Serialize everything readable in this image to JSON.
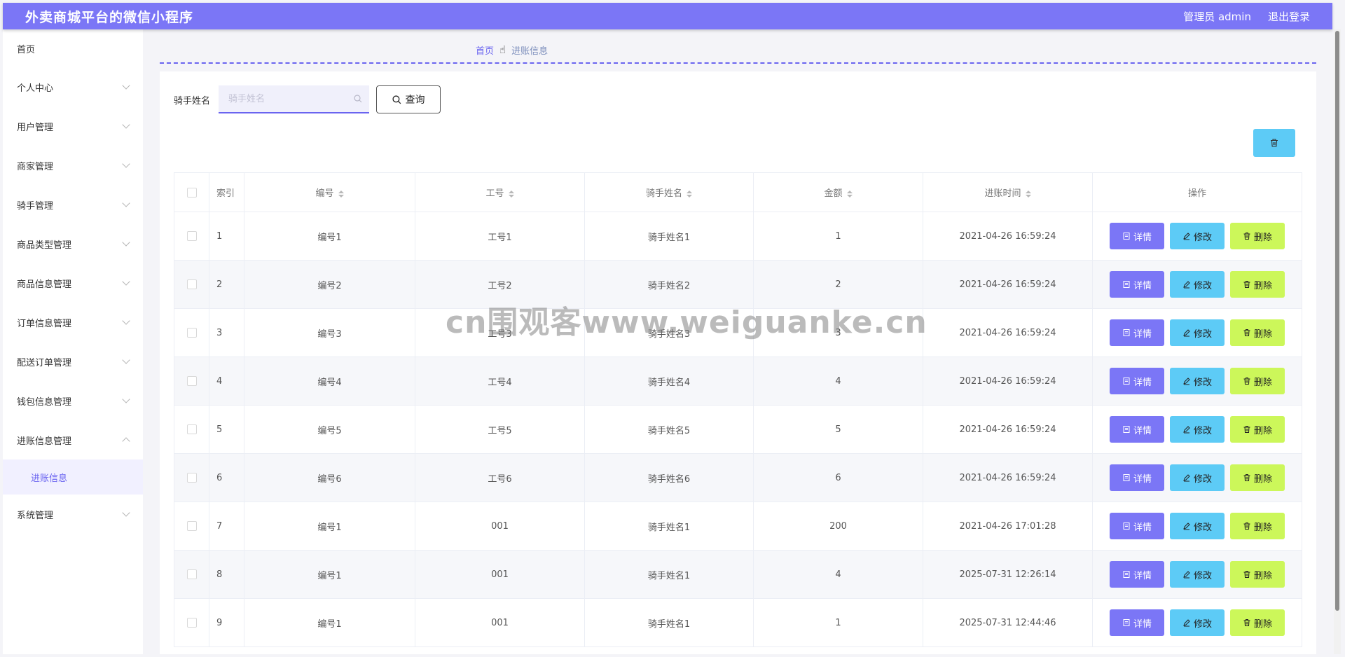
{
  "header": {
    "title": "外卖商城平台的微信小程序",
    "user": "管理员 admin",
    "logout": "退出登录"
  },
  "sidebar": {
    "items": [
      {
        "label": "首页",
        "chevron": false
      },
      {
        "label": "个人中心",
        "chevron": true
      },
      {
        "label": "用户管理",
        "chevron": true
      },
      {
        "label": "商家管理",
        "chevron": true
      },
      {
        "label": "骑手管理",
        "chevron": true
      },
      {
        "label": "商品类型管理",
        "chevron": true
      },
      {
        "label": "商品信息管理",
        "chevron": true
      },
      {
        "label": "订单信息管理",
        "chevron": true
      },
      {
        "label": "配送订单管理",
        "chevron": true
      },
      {
        "label": "钱包信息管理",
        "chevron": true
      },
      {
        "label": "进账信息管理",
        "chevron": true,
        "expanded": true
      },
      {
        "label": "系统管理",
        "chevron": true
      }
    ],
    "submenu": {
      "label": "进账信息"
    }
  },
  "breadcrumb": {
    "home": "首页",
    "current": "进账信息"
  },
  "search": {
    "label": "骑手姓名",
    "placeholder": "骑手姓名",
    "value": "",
    "button": "查询"
  },
  "table": {
    "columns": [
      "索引",
      "编号",
      "工号",
      "骑手姓名",
      "金额",
      "进账时间",
      "操作"
    ],
    "rows": [
      {
        "idx": "1",
        "bianhao": "编号1",
        "gonghao": "工号1",
        "name": "骑手姓名1",
        "amount": "1",
        "time": "2021-04-26 16:59:24"
      },
      {
        "idx": "2",
        "bianhao": "编号2",
        "gonghao": "工号2",
        "name": "骑手姓名2",
        "amount": "2",
        "time": "2021-04-26 16:59:24"
      },
      {
        "idx": "3",
        "bianhao": "编号3",
        "gonghao": "工号3",
        "name": "骑手姓名3",
        "amount": "3",
        "time": "2021-04-26 16:59:24"
      },
      {
        "idx": "4",
        "bianhao": "编号4",
        "gonghao": "工号4",
        "name": "骑手姓名4",
        "amount": "4",
        "time": "2021-04-26 16:59:24"
      },
      {
        "idx": "5",
        "bianhao": "编号5",
        "gonghao": "工号5",
        "name": "骑手姓名5",
        "amount": "5",
        "time": "2021-04-26 16:59:24"
      },
      {
        "idx": "6",
        "bianhao": "编号6",
        "gonghao": "工号6",
        "name": "骑手姓名6",
        "amount": "6",
        "time": "2021-04-26 16:59:24"
      },
      {
        "idx": "7",
        "bianhao": "编号1",
        "gonghao": "001",
        "name": "骑手姓名1",
        "amount": "200",
        "time": "2021-04-26 17:01:28"
      },
      {
        "idx": "8",
        "bianhao": "编号1",
        "gonghao": "001",
        "name": "骑手姓名1",
        "amount": "4",
        "time": "2025-07-31 12:26:14"
      },
      {
        "idx": "9",
        "bianhao": "编号1",
        "gonghao": "001",
        "name": "骑手姓名1",
        "amount": "1",
        "time": "2025-07-31 12:44:46"
      }
    ],
    "actions": {
      "detail": "详情",
      "edit": "修改",
      "delete": "删除"
    }
  },
  "watermark": "cn围观客www.weiguanke.cn",
  "colors": {
    "accent": "#7b76f6",
    "edit": "#5dcbf6",
    "delete": "#ccf75a"
  }
}
